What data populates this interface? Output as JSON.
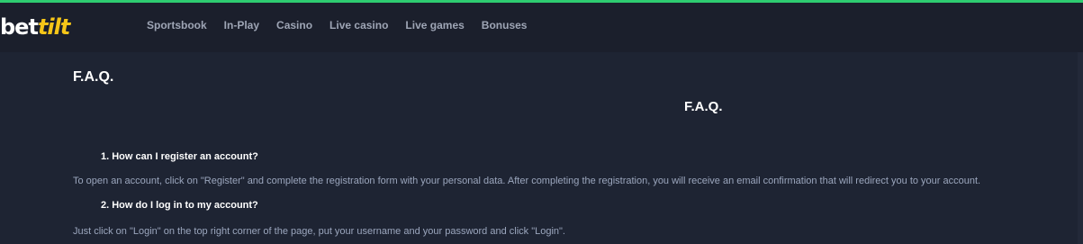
{
  "header": {
    "logo": {
      "part1": "bet",
      "part2": "tilt"
    },
    "nav": [
      {
        "label": "Sportsbook"
      },
      {
        "label": "In-Play"
      },
      {
        "label": "Casino"
      },
      {
        "label": "Live casino"
      },
      {
        "label": "Live games"
      },
      {
        "label": "Bonuses"
      }
    ],
    "accent_color": "#2ecc71",
    "logo_accent_color": "#f5c518"
  },
  "main": {
    "page_title": "F.A.Q.",
    "center_title": "F.A.Q.",
    "faq": [
      {
        "question": "1. How can I register an account?",
        "answer": "To open an account, click on \"Register\" and complete the registration form with your personal data. After completing the registration, you will receive an email confirmation that will redirect you to your account."
      },
      {
        "question": "2. How do I log in to my account?",
        "answer": "Just click on \"Login\" on the top right corner of the page, put your username and your password and click \"Login\"."
      }
    ]
  }
}
